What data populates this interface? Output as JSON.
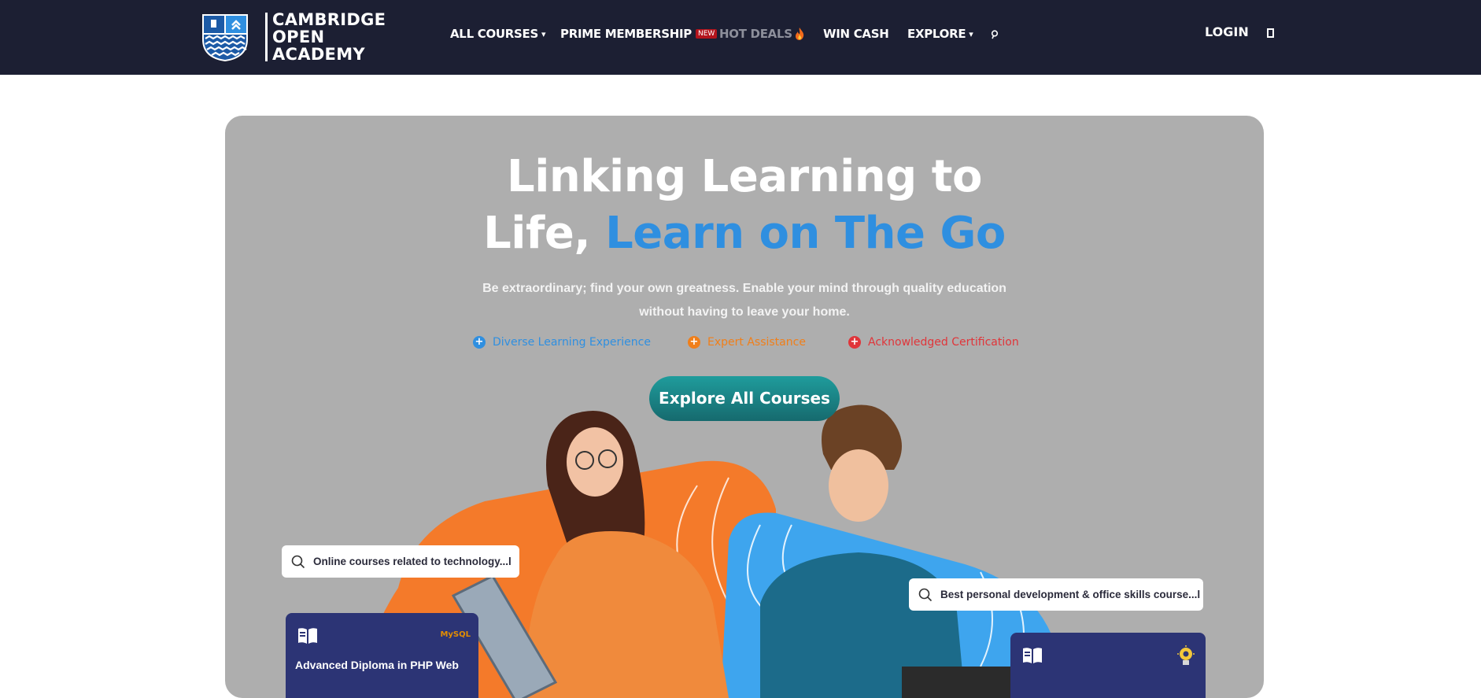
{
  "brand": {
    "name_lines": [
      "CAMBRIDGE",
      "OPEN",
      "ACADEMY"
    ]
  },
  "nav": {
    "items": [
      {
        "label": "ALL COURSES",
        "caret": "▾"
      },
      {
        "label": "PRIME MEMBERSHIP",
        "badge": "NEW"
      },
      {
        "label": "HOT DEALS"
      },
      {
        "label": "WIN CASH"
      },
      {
        "label": "EXPLORE",
        "caret": "▾"
      }
    ],
    "login": "LOGIN"
  },
  "hero": {
    "title_line1": "Linking Learning to",
    "title_line2_plain": "Life, ",
    "title_line2_accent": "Learn on The Go",
    "subtitle": "Be extraordinary; find your own greatness. Enable your mind through quality education without having to leave your home.",
    "features": [
      {
        "label": "Diverse Learning Experience",
        "color": "#2f8fe0"
      },
      {
        "label": "Expert Assistance",
        "color": "#f07f1a"
      },
      {
        "label": "Acknowledged Certification",
        "color": "#e0353a"
      }
    ],
    "cta": "Explore All Courses",
    "search_left": "Online courses related to technology...l",
    "search_right": "Best personal development & office skills course...l",
    "card_left_title": "Advanced Diploma in PHP Web",
    "card_left_logo": "MySQL"
  },
  "colors": {
    "nav_bg": "#1c1f33",
    "hero_bg": "#aeaeae",
    "accent_blue": "#2f8fe0",
    "cta_teal": "#1f8a8c",
    "card_navy": "#2c3475"
  }
}
